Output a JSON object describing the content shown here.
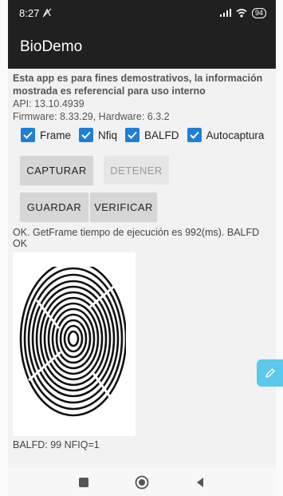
{
  "status_bar": {
    "time": "8:27",
    "battery": "94"
  },
  "app_bar": {
    "title": "BioDemo"
  },
  "info": {
    "disclaimer": "Esta app es para fines demostrativos, la información mostrada es referencial para uso interno",
    "api": "API: 13.10.4939",
    "versions": "Firmware: 8.33.29, Hardware: 6.3.2"
  },
  "options": [
    {
      "label": "Frame",
      "checked": true
    },
    {
      "label": "Nfiq",
      "checked": true
    },
    {
      "label": "BALFD",
      "checked": true
    },
    {
      "label": "Autocaptura",
      "checked": true
    }
  ],
  "buttons": {
    "capture": "CAPTURAR",
    "stop": "DETENER",
    "save": "GUARDAR",
    "verify": "VERIFICAR"
  },
  "result": {
    "message": "OK. GetFrame tiempo de ejecución es 992(ms). BALFD OK",
    "metrics": "BALFD: 99   NFIQ=1"
  },
  "icons": {
    "edit_fab": "pencil-icon",
    "nav_recent": "square-icon",
    "nav_home": "circle-icon",
    "nav_back": "triangle-back-icon"
  },
  "colors": {
    "app_bar": "#202020",
    "checkbox": "#1e7fd6",
    "fab": "#5bc8ec"
  }
}
